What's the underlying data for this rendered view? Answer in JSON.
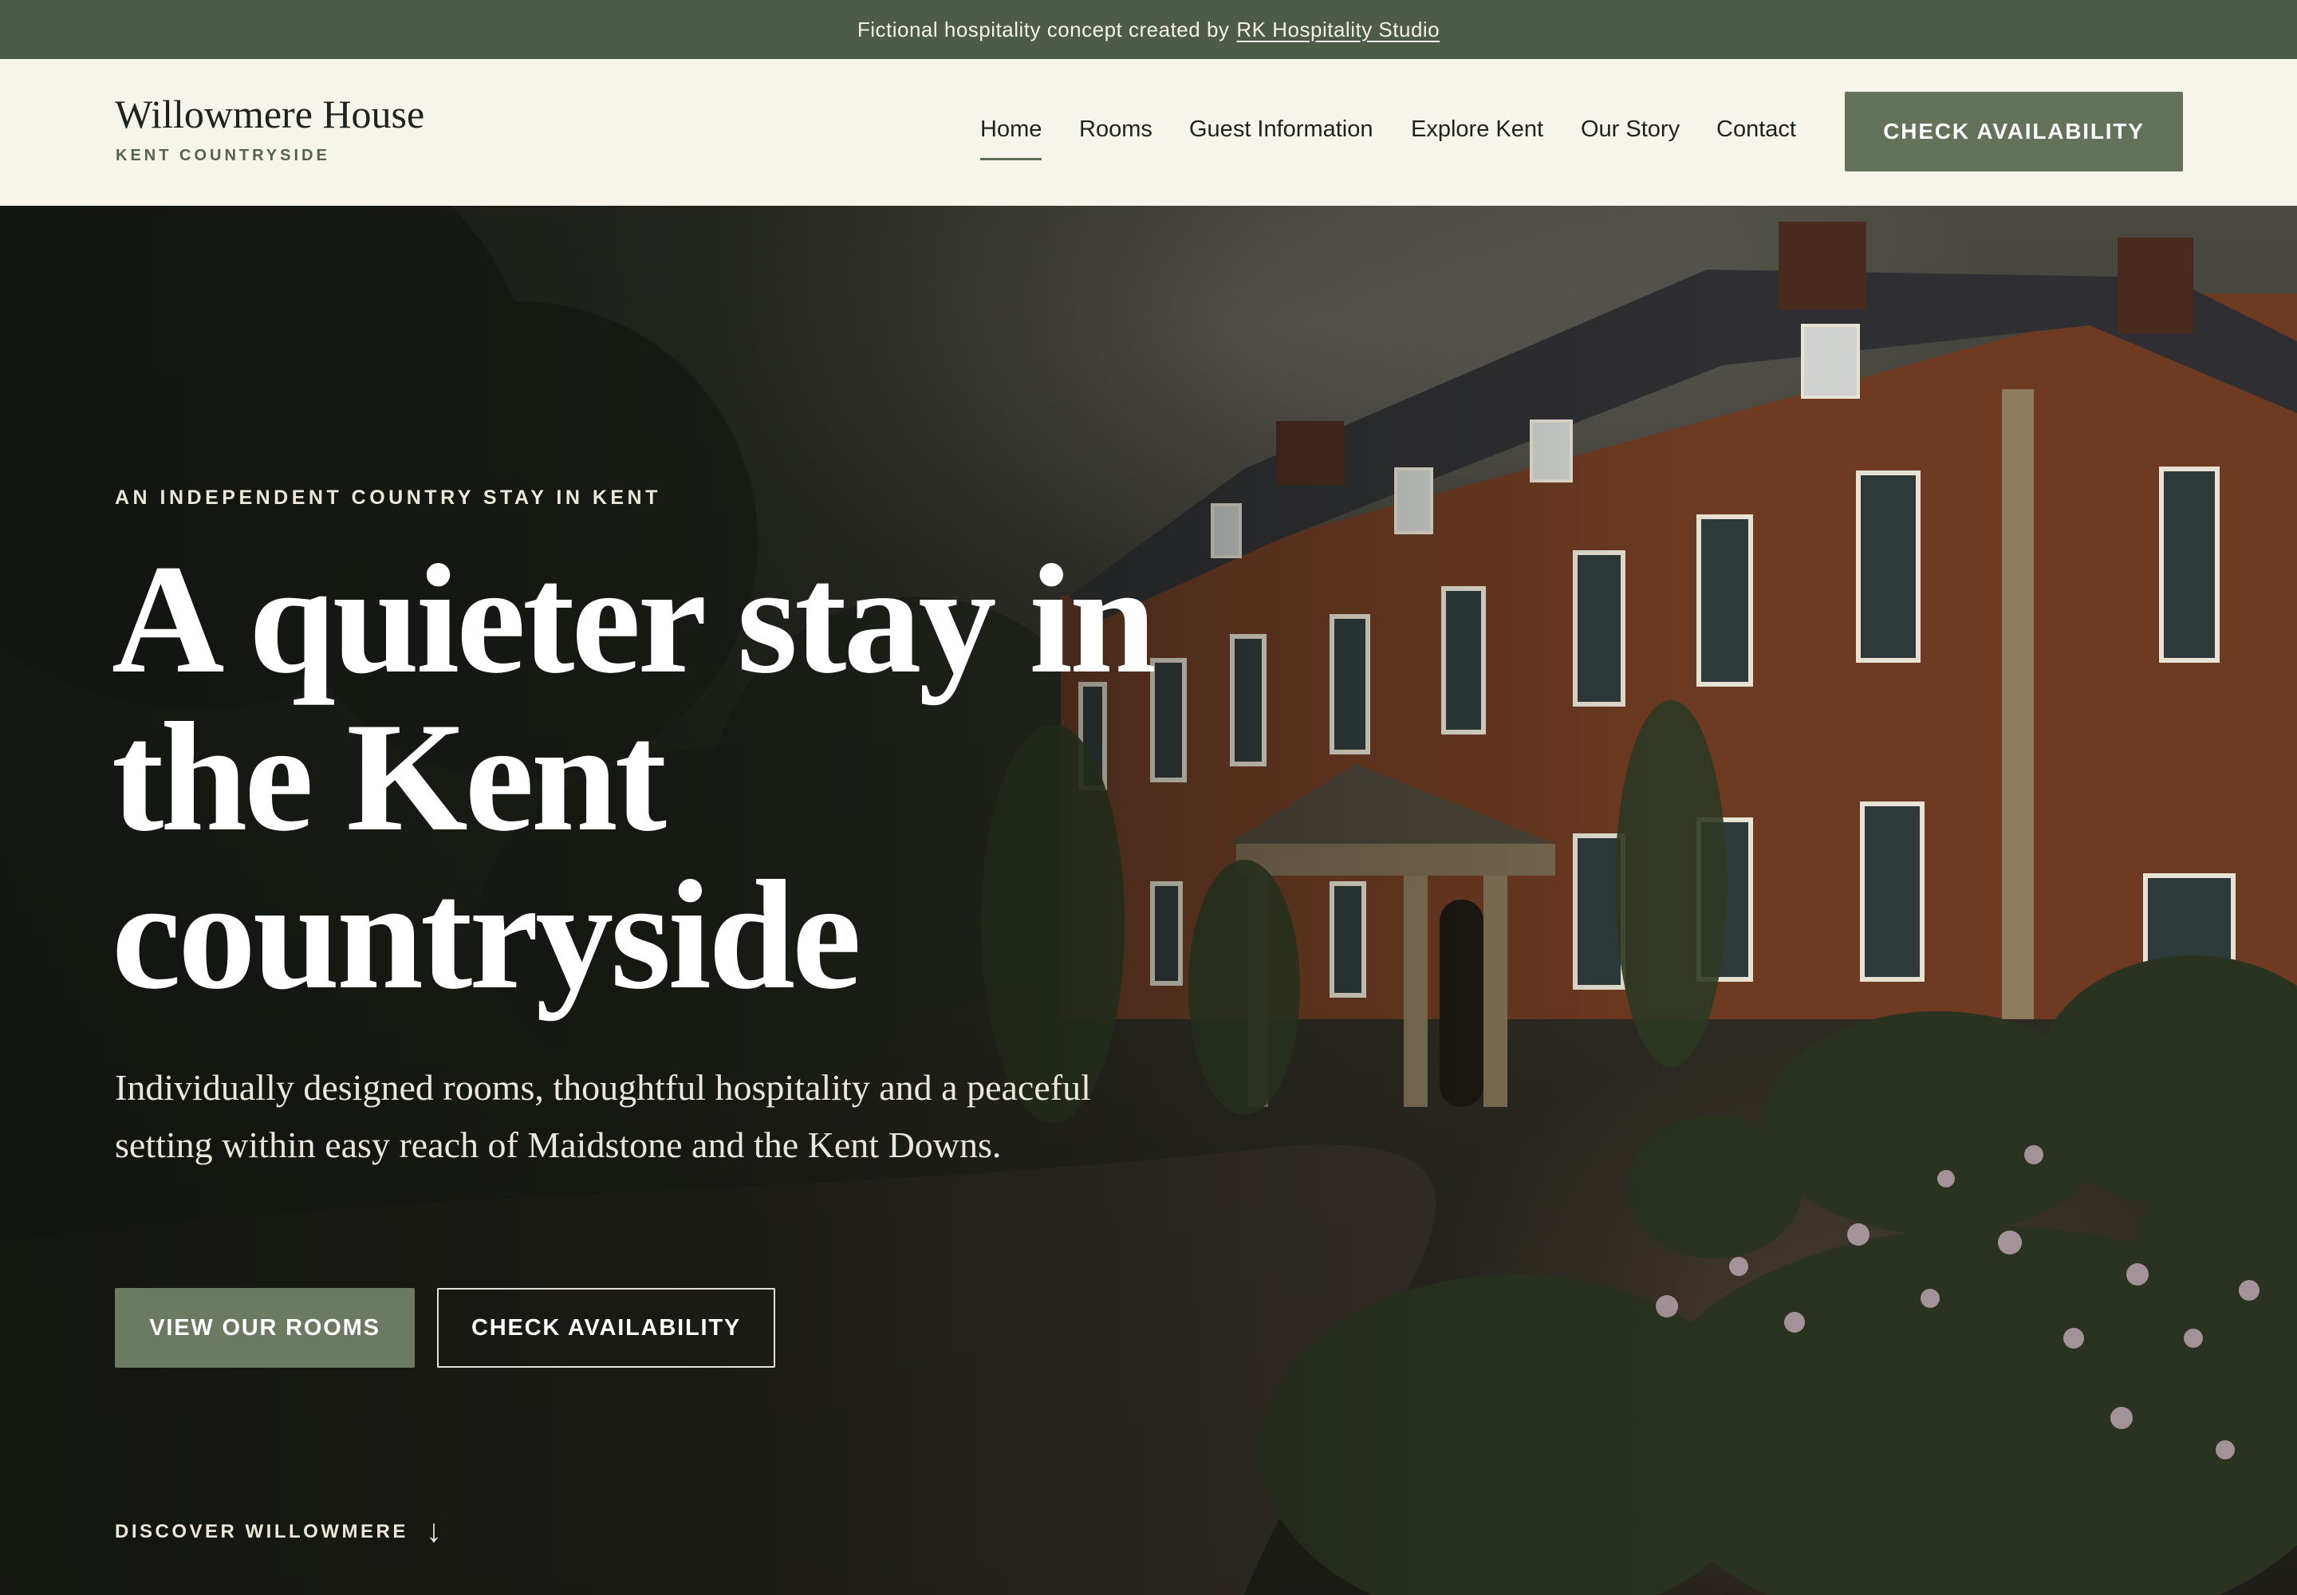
{
  "topbar": {
    "text": "Fictional hospitality concept created by",
    "link": "RK Hospitality Studio"
  },
  "brand": {
    "name": "Willowmere House",
    "subtitle": "KENT COUNTRYSIDE"
  },
  "nav": {
    "items": [
      {
        "label": "Home",
        "active": true
      },
      {
        "label": "Rooms"
      },
      {
        "label": "Guest Information"
      },
      {
        "label": "Explore Kent"
      },
      {
        "label": "Our Story"
      },
      {
        "label": "Contact"
      }
    ],
    "cta": "CHECK AVAILABILITY"
  },
  "hero": {
    "eyebrow": "AN INDEPENDENT COUNTRY STAY IN KENT",
    "headline_lines": [
      "A quieter stay in",
      "the Kent",
      "countryside"
    ],
    "subcopy": "Individually designed rooms, thoughtful hospitality and a peaceful setting within easy reach of Maidstone and the Kent Downs.",
    "primary_button": "VIEW OUR ROOMS",
    "secondary_button": "CHECK AVAILABILITY",
    "discover": "DISCOVER WILLOWMERE",
    "discover_arrow": "↓"
  },
  "colors": {
    "topbar": "#4e5b47",
    "header_bg": "#f7f4ec",
    "accent": "#637259",
    "brick": "#7a3f26"
  }
}
